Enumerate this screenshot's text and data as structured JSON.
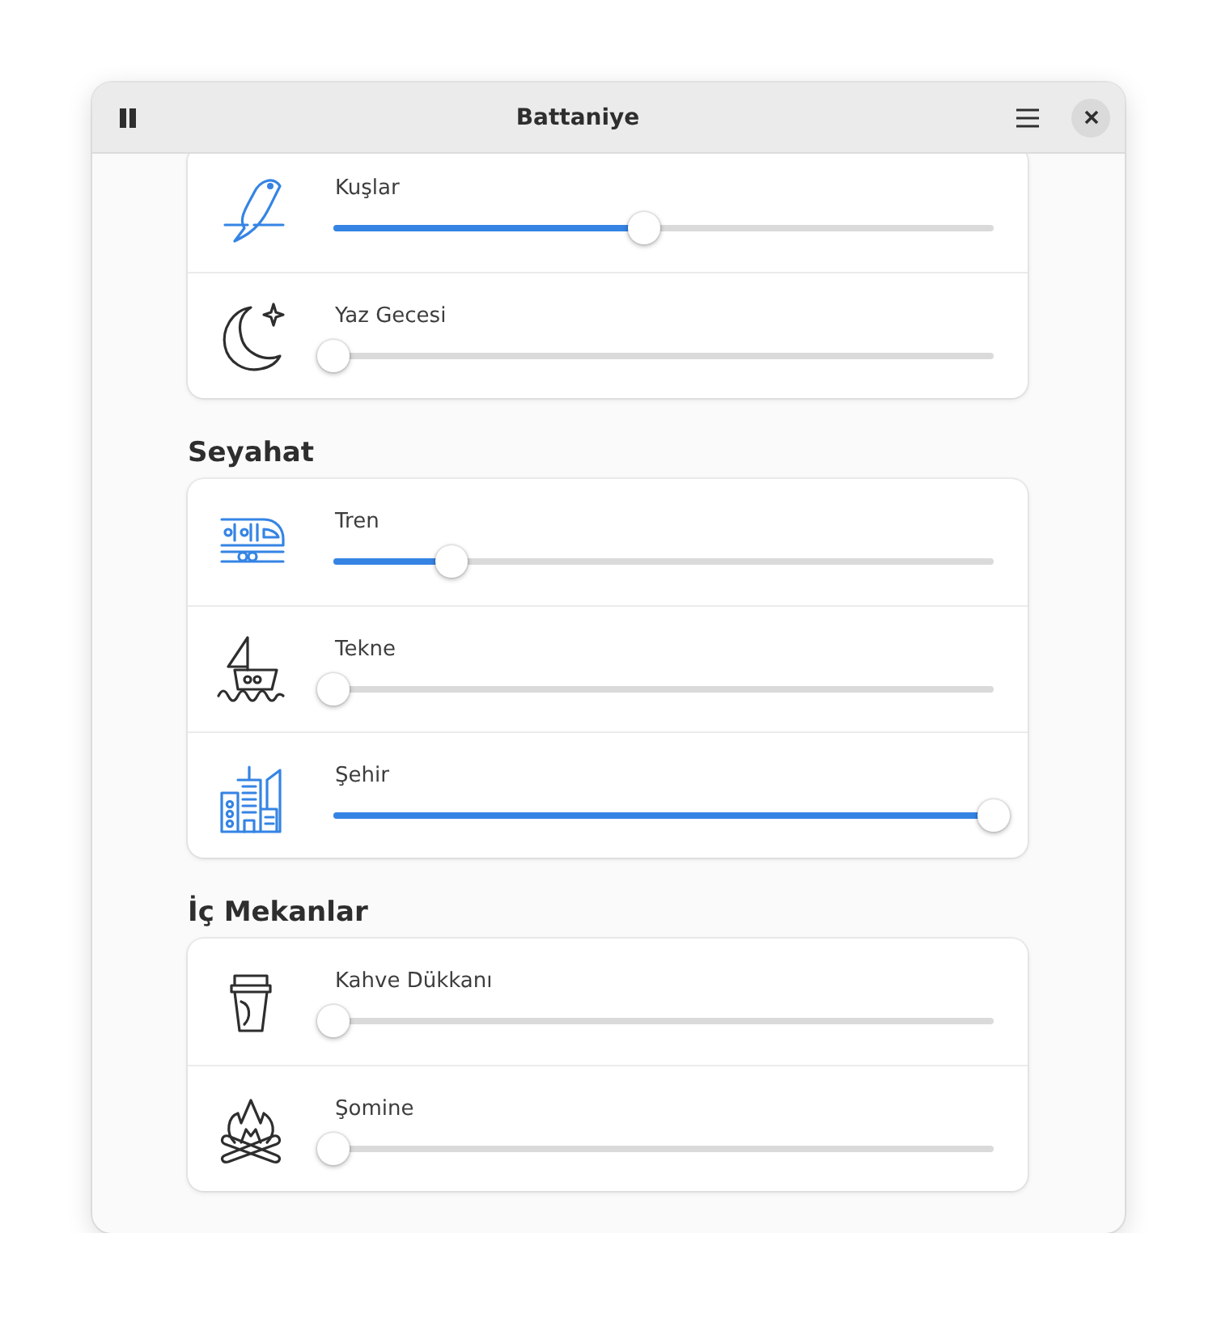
{
  "window": {
    "title": "Battaniye"
  },
  "sections": [
    {
      "sounds": [
        {
          "name": "Kuşlar",
          "level": 0.47
        },
        {
          "name": "Yaz Gecesi",
          "level": 0
        }
      ]
    },
    {
      "title": "Seyahat",
      "sounds": [
        {
          "name": "Tren",
          "level": 0.18
        },
        {
          "name": "Tekne",
          "level": 0
        },
        {
          "name": "Şehir",
          "level": 1
        }
      ]
    },
    {
      "title": "İç Mekanlar",
      "sounds": [
        {
          "name": "Kahve Dükkanı",
          "level": 0
        },
        {
          "name": "Şomine",
          "level": 0
        }
      ]
    }
  ]
}
